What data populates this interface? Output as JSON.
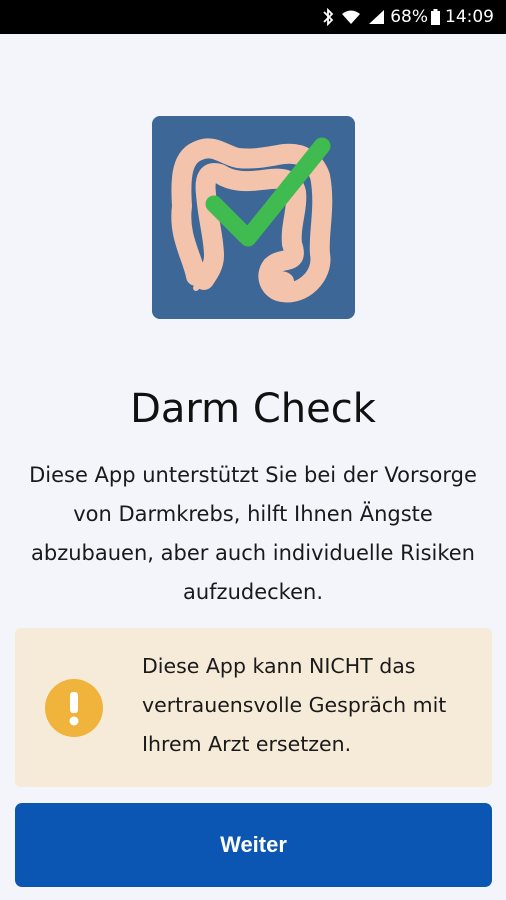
{
  "status_bar": {
    "battery": "68%",
    "time": "14:09",
    "icons": [
      "bluetooth-icon",
      "wifi-icon",
      "signal-icon",
      "battery-icon"
    ]
  },
  "app": {
    "logo_icon": "colon-with-checkmark-icon",
    "title": "Darm Check",
    "description": "Diese App unterstützt Sie bei der Vorsorge von Darmkrebs, hilft Ihnen Ängste abzubauen, aber auch individuelle Risiken aufzudecken."
  },
  "warning": {
    "icon": "exclamation-icon",
    "text": "Diese App kann NICHT das vertrauensvolle Gespräch mit Ihrem Arzt ersetzen."
  },
  "button": {
    "label": "Weiter"
  },
  "colors": {
    "background": "#f4f5fa",
    "logo_background": "#3d6796",
    "colon": "#f3c3ac",
    "check": "#3fbb4f",
    "warning_background": "#f6ebd9",
    "warning_icon": "#f0b33c",
    "button": "#0c56b3"
  }
}
